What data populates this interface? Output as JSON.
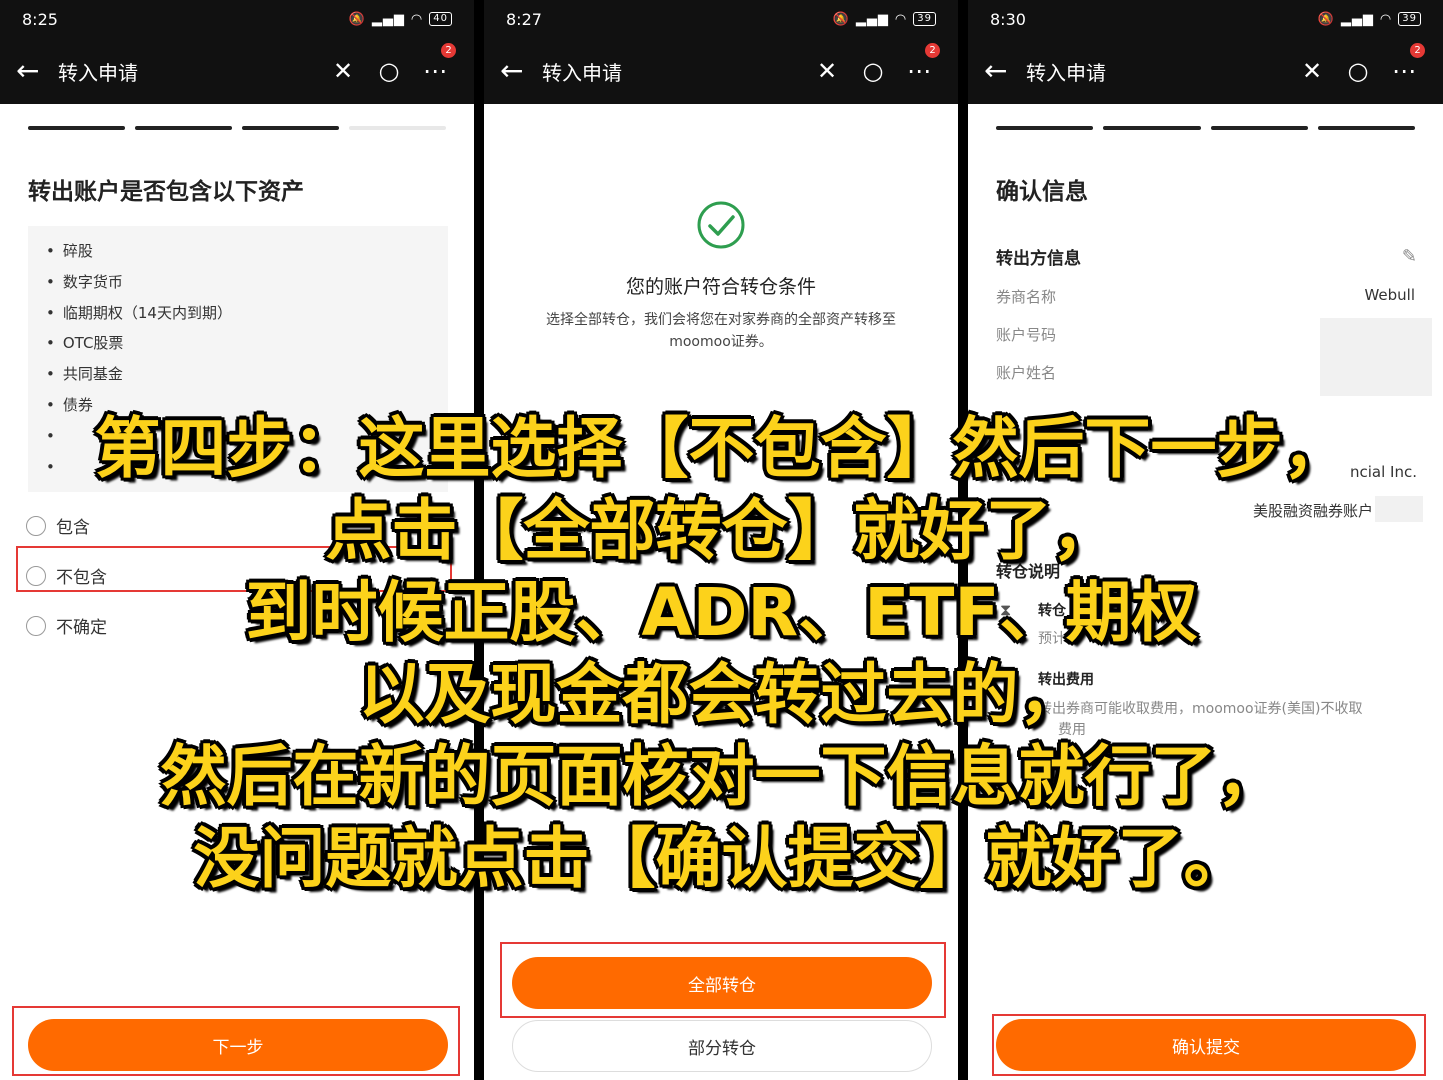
{
  "panel1": {
    "status": {
      "time": "8:25",
      "battery": "40"
    },
    "appbar": {
      "title": "转入申请",
      "badge": "2"
    },
    "question": "转出账户是否包含以下资产",
    "assets": [
      "碎股",
      "数字货币",
      "临期期权（14天内到期）",
      "OTC股票",
      "共同基金",
      "债券",
      "",
      ""
    ],
    "options": [
      "包含",
      "不包含",
      "不确定"
    ],
    "next_label": "下一步"
  },
  "panel2": {
    "status": {
      "time": "8:27",
      "battery": "39"
    },
    "appbar": {
      "title": "转入申请",
      "badge": "2"
    },
    "success_title": "您的账户符合转仓条件",
    "success_desc_1": "选择全部转仓，我们会将您在对家券商的全部资产转移至",
    "success_desc_2": "moomoo证券。",
    "all_transfer_label": "全部转仓",
    "partial_transfer_label": "部分转仓"
  },
  "panel3": {
    "status": {
      "time": "8:30",
      "battery": "39"
    },
    "appbar": {
      "title": "转入申请",
      "badge": "2"
    },
    "title": "确认信息",
    "section_out": "转出方信息",
    "broker_label": "券商名称",
    "broker_value": "Webull",
    "account_no_label": "账户号码",
    "account_name_label": "账户姓名",
    "in_company": "ncial Inc.",
    "in_account_type": "美股融资融券账户",
    "transfer_note_title": "转仓说明",
    "item1_title": "转仓",
    "item1_desc": "预计",
    "item2_title": "转出费用",
    "item2_desc_1": "转出券商可能收取费用，moomoo证券(美国)不收取",
    "item2_desc_2": "费用",
    "confirm_label": "确认提交"
  },
  "overlay_lines": [
    "第四步：这里选择【不包含】然后下一步，",
    "点击【全部转仓】就好了，",
    "到时候正股、ADR、ETF、期权",
    "以及现金都会转过去的，",
    "然后在新的页面核对一下信息就行了，",
    "没问题就点击【确认提交】就好了。"
  ],
  "colors": {
    "accent": "#ff6a00",
    "highlight_box": "#e53935",
    "overlay_text": "#fcd21b",
    "success": "#2e9e4f"
  }
}
